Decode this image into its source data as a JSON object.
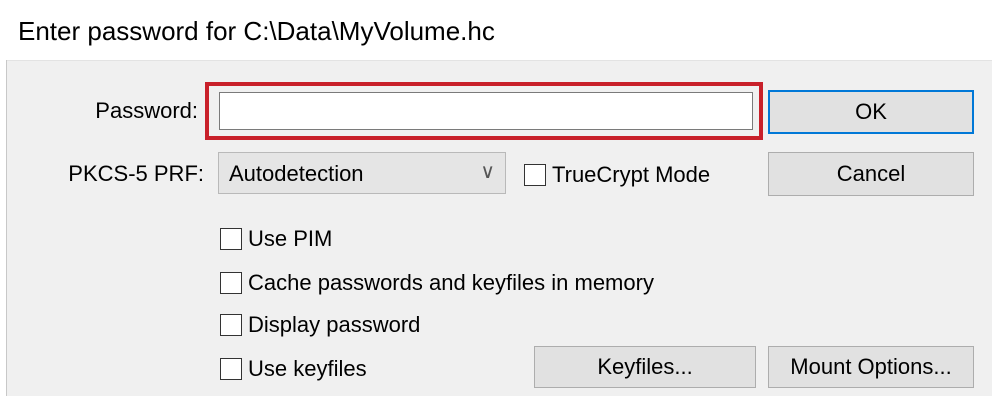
{
  "dialog": {
    "title": "Enter password for C:\\Data\\MyVolume.hc"
  },
  "password": {
    "label": "Password:",
    "value": ""
  },
  "prf": {
    "label": "PKCS-5 PRF:",
    "selected": "Autodetection",
    "truecrypt_label": "TrueCrypt Mode",
    "truecrypt_checked": false
  },
  "buttons": {
    "ok": "OK",
    "cancel": "Cancel",
    "keyfiles": "Keyfiles...",
    "mount_options": "Mount Options..."
  },
  "options": {
    "use_pim": "Use PIM",
    "cache": "Cache passwords and keyfiles in memory",
    "display_password": "Display password",
    "use_keyfiles": "Use keyfiles"
  },
  "colors": {
    "highlight": "#c8202a",
    "default_button_border": "#0078d7"
  }
}
